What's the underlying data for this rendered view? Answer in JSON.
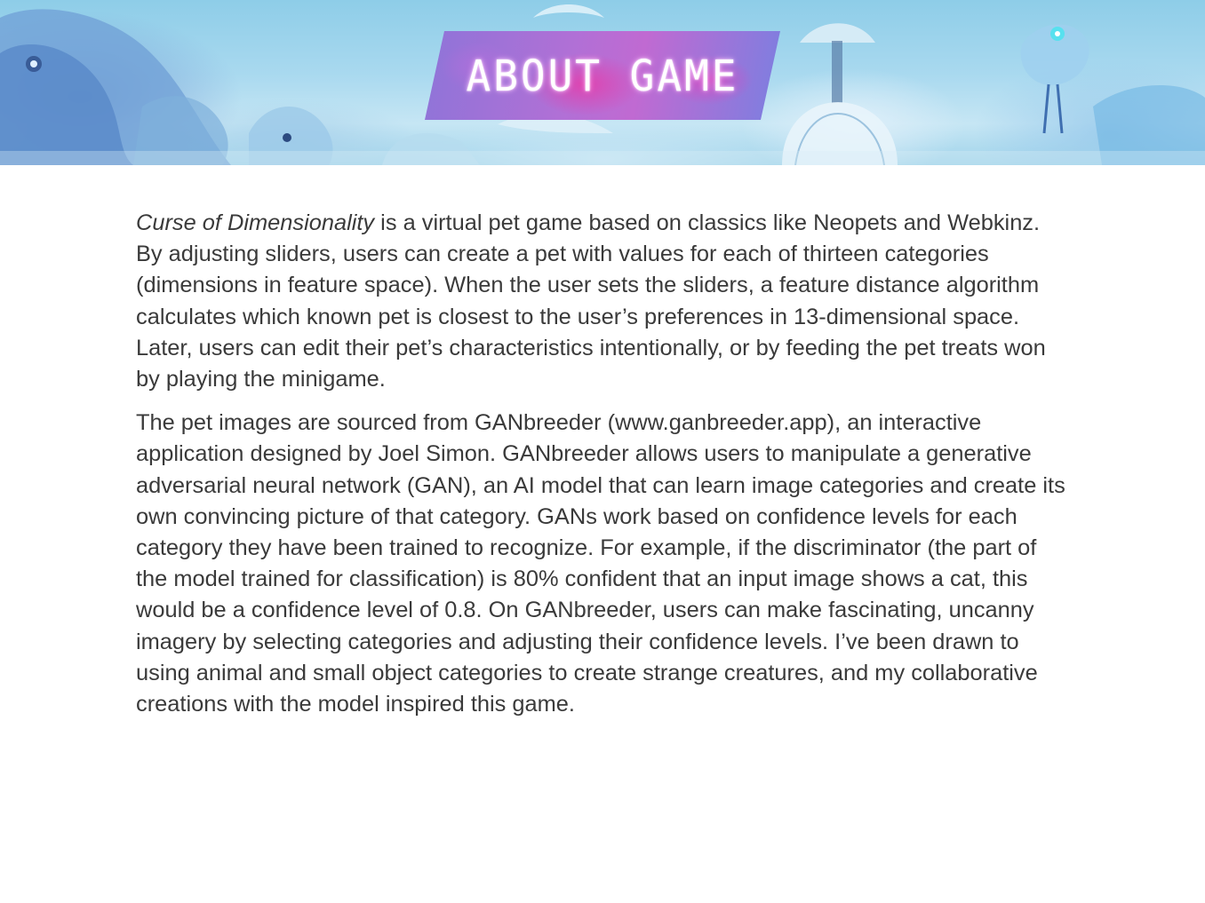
{
  "header": {
    "title": "ABOUT GAME"
  },
  "about": {
    "paragraph1": {
      "game_title": "Curse of Dimensionality",
      "text": " is a virtual pet game based on classics like Neopets and Webkinz. By adjusting sliders, users can create a pet with values for each of thirteen categories (dimensions in feature space). When the user sets the sliders, a feature distance algorithm calculates which known pet is closest to the user’s preferences in 13-dimensional space. Later, users can edit their pet’s characteristics intentionally, or by feeding the pet treats won by playing the minigame."
    },
    "paragraph2": {
      "text": "The pet images are sourced from GANbreeder (www.ganbreeder.app), an interactive application designed by Joel Simon. GANbreeder allows users to manipulate a generative adversarial neural network (GAN), an AI model that can learn image categories and create its own convincing picture of that category. GANs work based on confidence levels for each category they have been trained to recognize. For example, if the discriminator (the part of the model trained for classification) is 80% confident that an input image shows a cat, this would be a confidence level of 0.8. On GANbreeder, users can make fascinating, uncanny imagery by selecting categories and adjusting their confidence levels. I’ve been drawn to using animal and small object categories to create strange creatures, and my collaborative creations with the model inspired this game."
    }
  },
  "colors": {
    "banner_sky": "#a9d9ef",
    "title_plate_purple": "#8e74d8",
    "title_plate_magenta": "#c06ad2",
    "body_text": "#3a3a3a",
    "page_background": "#ffffff"
  },
  "icons": {
    "banner_image": "ganbreeder-creatures-banner"
  }
}
